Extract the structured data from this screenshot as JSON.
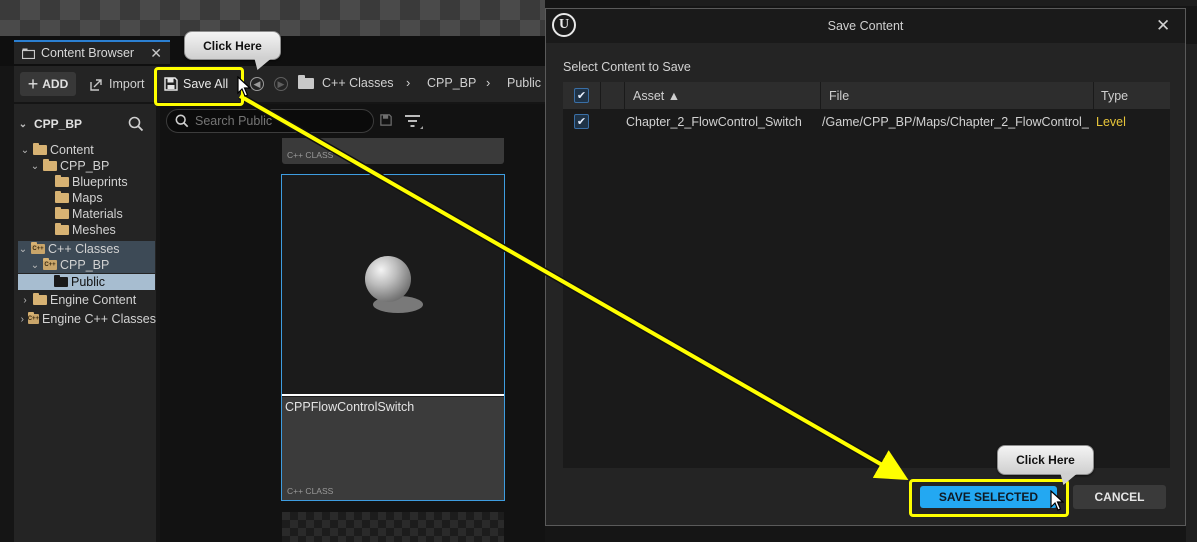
{
  "content_browser": {
    "tab_label": "Content Browser",
    "close_glyph": "✕",
    "toolbar": {
      "add_label": "ADD",
      "import_label": "Import",
      "save_all_label": "Save All"
    },
    "breadcrumbs": [
      "C++ Classes",
      "CPP_BP",
      "Public"
    ],
    "search_placeholder": "Search Public",
    "sources": {
      "title": "CPP_BP",
      "tree": [
        {
          "label": "Content"
        },
        {
          "label": "CPP_BP"
        },
        {
          "label": "Blueprints"
        },
        {
          "label": "Maps"
        },
        {
          "label": "Materials"
        },
        {
          "label": "Meshes"
        },
        {
          "label": "C++ Classes"
        },
        {
          "label": "CPP_BP"
        },
        {
          "label": "Public"
        },
        {
          "label": "Engine Content"
        },
        {
          "label": "Engine C++ Classes"
        }
      ]
    },
    "assets": [
      {
        "type_label": "C++ CLASS"
      },
      {
        "name": "CPPFlowControlSwitch",
        "type_label": "C++ CLASS"
      }
    ]
  },
  "callouts": {
    "first": "Click Here",
    "second": "Click Here"
  },
  "dialog": {
    "logo": "U",
    "title": "Save Content",
    "close_glyph": "✕",
    "subtitle": "Select Content to Save",
    "columns": {
      "asset": "Asset ▲",
      "file": "File",
      "type": "Type"
    },
    "rows": [
      {
        "checked": true,
        "asset": "Chapter_2_FlowControl_Switch",
        "file": "/Game/CPP_BP/Maps/Chapter_2_FlowControl_",
        "type": "Level"
      }
    ],
    "save_button": "SAVE SELECTED",
    "cancel_button": "CANCEL"
  },
  "colors": {
    "highlight": "#ffff00",
    "accent_blue": "#23a8f2",
    "level_type": "#e8c63a",
    "folder": "#d7b273"
  }
}
